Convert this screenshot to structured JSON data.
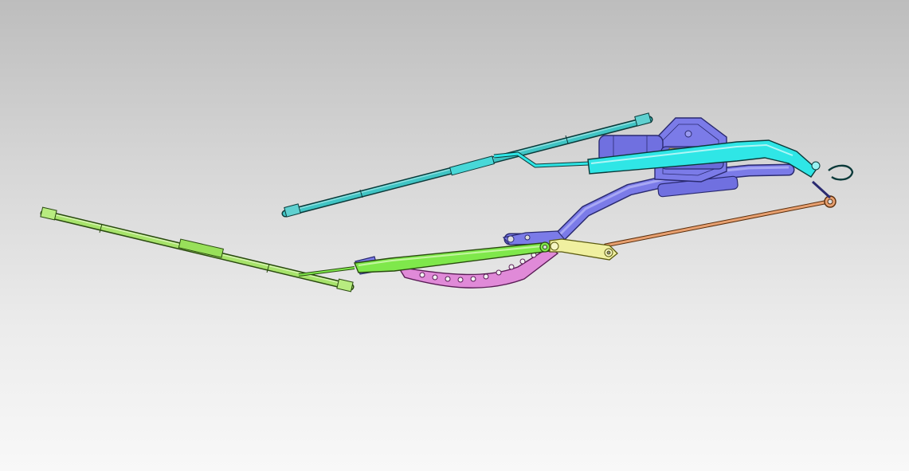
{
  "viewport": {
    "background_top": "#bdbdbd",
    "background_bottom": "#f8f8f8"
  },
  "parts": [
    {
      "name": "wiper-blade-left",
      "color": "#a7e36b"
    },
    {
      "name": "wiper-arm-left",
      "color": "#7fe84b"
    },
    {
      "name": "linkage-bracket-perforated",
      "color": "#e08ad8"
    },
    {
      "name": "wiper-blade-right",
      "color": "#40c4c4"
    },
    {
      "name": "wiper-arm-right",
      "color": "#2fe6e6"
    },
    {
      "name": "motor-frame-tube",
      "color": "#7b7be8"
    },
    {
      "name": "wiper-motor",
      "color": "#7070e0"
    },
    {
      "name": "connecting-rod",
      "color": "#e8a070"
    },
    {
      "name": "crank-link",
      "color": "#f0f0a0"
    }
  ]
}
